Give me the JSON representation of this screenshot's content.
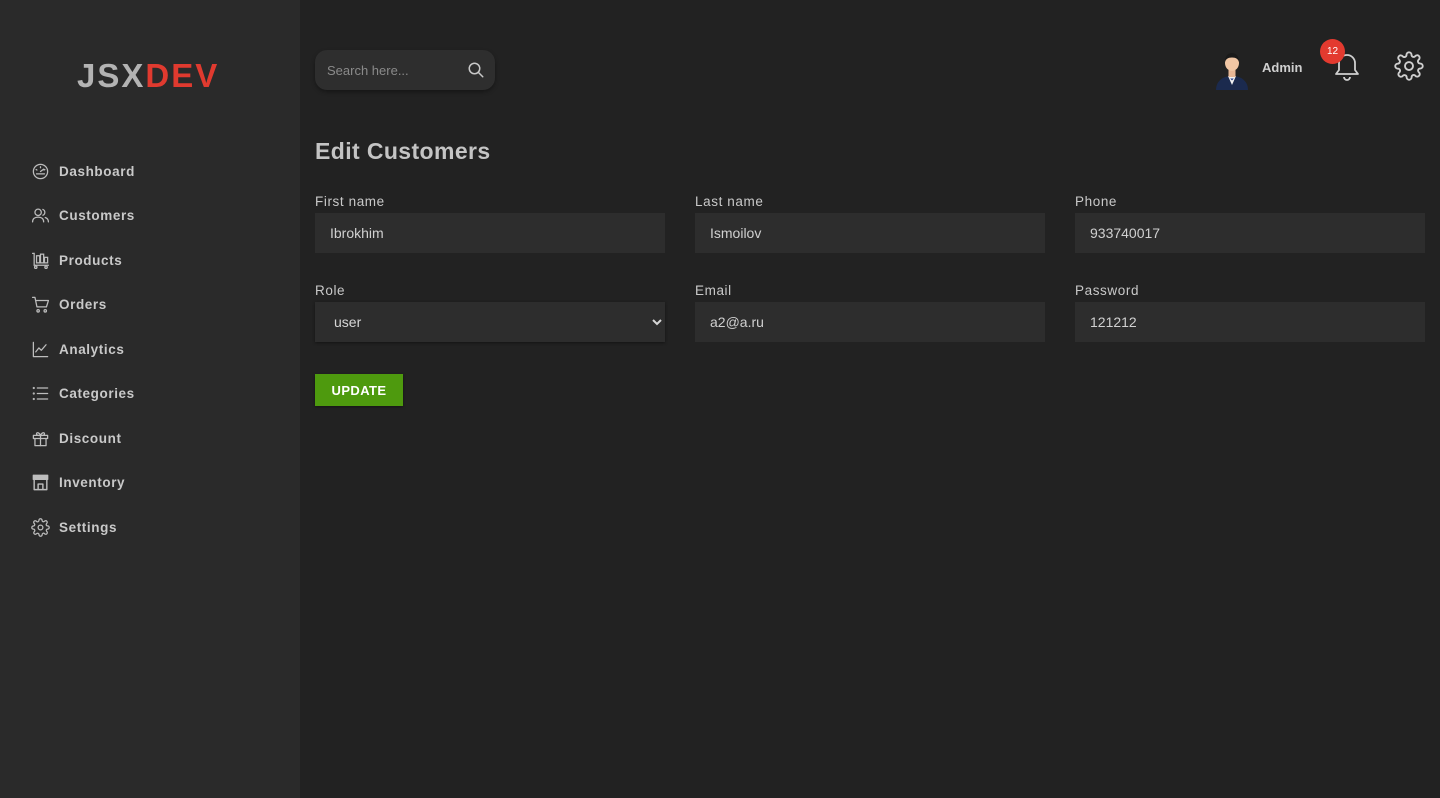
{
  "logo": {
    "part1": "JSX",
    "part2": "DEV"
  },
  "sidebar": {
    "items": [
      {
        "label": "Dashboard",
        "icon": "dashboard-gauge-icon"
      },
      {
        "label": "Customers",
        "icon": "users-icon"
      },
      {
        "label": "Products",
        "icon": "cart-trolley-icon"
      },
      {
        "label": "Orders",
        "icon": "shopping-cart-icon"
      },
      {
        "label": "Analytics",
        "icon": "line-chart-icon"
      },
      {
        "label": "Categories",
        "icon": "list-icon"
      },
      {
        "label": "Discount",
        "icon": "gift-icon"
      },
      {
        "label": "Inventory",
        "icon": "store-icon"
      },
      {
        "label": "Settings",
        "icon": "gear-icon"
      }
    ]
  },
  "header": {
    "search_placeholder": "Search here...",
    "user_name": "Admin",
    "notification_count": "12"
  },
  "page": {
    "title": "Edit Customers"
  },
  "form": {
    "first_name": {
      "label": "First name",
      "value": "Ibrokhim"
    },
    "last_name": {
      "label": "Last name",
      "value": "Ismoilov"
    },
    "phone": {
      "label": "Phone",
      "value": "933740017"
    },
    "role": {
      "label": "Role",
      "value": "user"
    },
    "email": {
      "label": "Email",
      "value": "a2@a.ru"
    },
    "password": {
      "label": "Password",
      "value": "121212"
    },
    "submit_label": "UPDATE"
  },
  "colors": {
    "background": "#222222",
    "sidebar": "#2a2a2a",
    "brand_red": "#e03a2f",
    "button_green": "#4e9a0e",
    "badge_red": "#e33a2f"
  }
}
